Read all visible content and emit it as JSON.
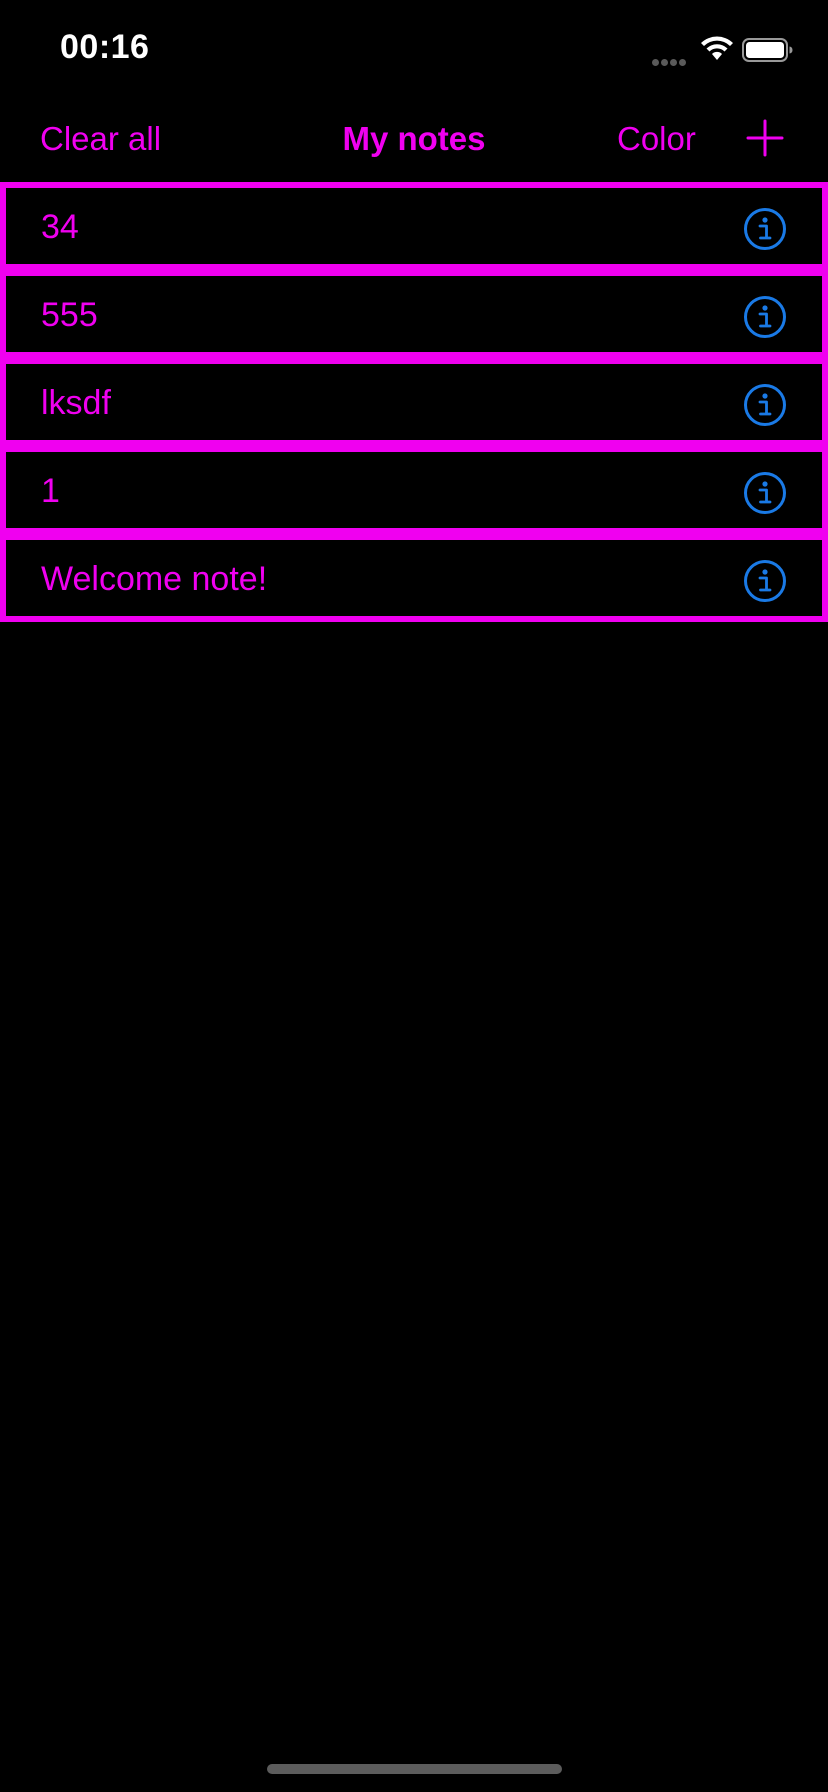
{
  "status_bar": {
    "time": "00:16",
    "icons": [
      "signal-icon",
      "wifi-icon",
      "battery-icon"
    ]
  },
  "nav": {
    "left_label": "Clear all",
    "title": "My notes",
    "right_label": "Color",
    "add_icon": "plus-icon"
  },
  "notes": [
    {
      "title": "34"
    },
    {
      "title": "555"
    },
    {
      "title": "lksdf"
    },
    {
      "title": "1"
    },
    {
      "title": "Welcome note!"
    }
  ],
  "colors": {
    "accent": "#f000f0",
    "info_icon": "#1a7ae6",
    "background": "#000000",
    "status_text": "#ffffff"
  }
}
